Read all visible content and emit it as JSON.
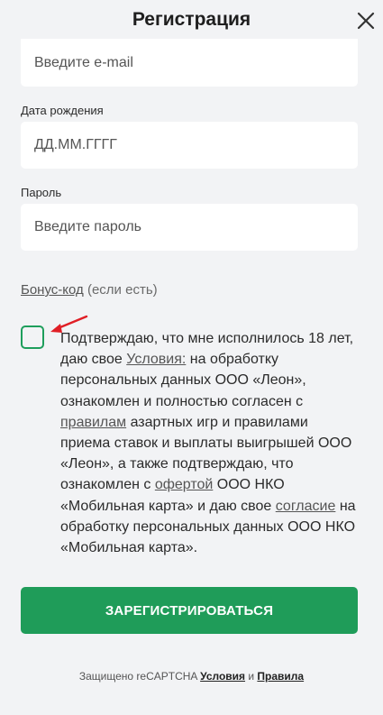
{
  "header": {
    "title": "Регистрация"
  },
  "form": {
    "email_placeholder": "Введите e-mail",
    "birth_label": "Дата рождения",
    "birth_placeholder": "ДД.ММ.ГГГГ",
    "password_label": "Пароль",
    "password_placeholder": "Введите пароль",
    "bonus_link": "Бонус-код",
    "bonus_suffix": " (если есть)"
  },
  "consent": {
    "checked": false,
    "t1": "Подтверждаю, что мне исполнилось 18 лет, даю свое ",
    "l1": "Условия:",
    "t2": " на обработку персональных данных ООО «Леон», ознакомлен и полностью согласен с ",
    "l2": "правилам",
    "t3": " азартных игр и правилами приема ставок и выплаты выигрышей ООО «Леон», а также подтверждаю, что ознакомлен с ",
    "l3": "офертой",
    "t4": " ООО НКО «Мобильная карта» и даю свое ",
    "l4": "согласие",
    "t5": " на обработку персональных данных ООО НКО «Мобильная карта»."
  },
  "actions": {
    "register_label": "ЗАРЕГИСТРИРОВАТЬСЯ"
  },
  "footer": {
    "text": "Защищено reCAPTCHA ",
    "terms": "Условия",
    "and": " и ",
    "rules": "Правила"
  },
  "icons": {
    "close": "close-icon",
    "arrow": "red-arrow-icon"
  },
  "colors": {
    "accent": "#1f9c59",
    "arrow": "#e01e25"
  }
}
